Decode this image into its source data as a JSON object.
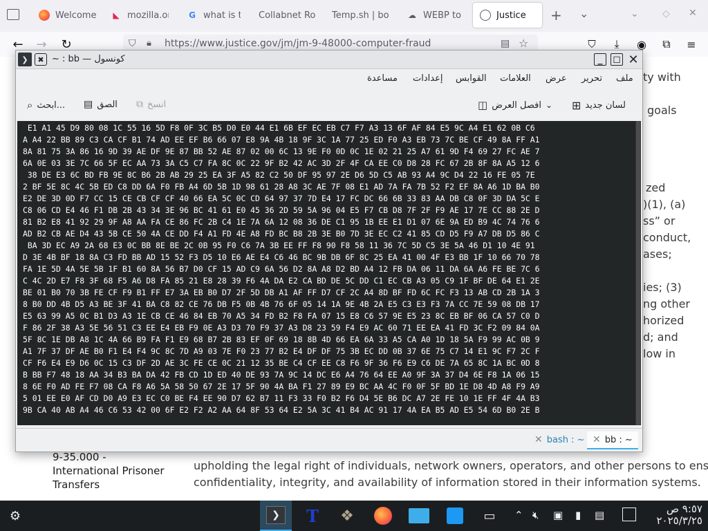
{
  "browser": {
    "tabs": [
      {
        "label": "Welcome",
        "icon": "firefox-icon"
      },
      {
        "label": "mozilla.or",
        "icon": "mozilla-icon"
      },
      {
        "label": "what is th",
        "icon": "google-icon"
      },
      {
        "label": "Collabnet Ro",
        "icon": "page-icon"
      },
      {
        "label": "Temp.sh | bo",
        "icon": "page-icon"
      },
      {
        "label": "WEBP to f",
        "icon": "cloud-icon"
      },
      {
        "label": "Justice",
        "icon": "justice-seal-icon"
      }
    ],
    "url": "https://www.justice.gov/jm/jm-9-48000-computer-fraud"
  },
  "page": {
    "fragments": {
      "ty_with": "ty with",
      "goals": "goals",
      "zed": "zed",
      "one_a": ")(1), (a)",
      "ss_or": "ss” or",
      "conduct": "conduct,",
      "ases": "ases;",
      "ies3": "ies; (3)",
      "ng_other": "ng other",
      "horized": "horized",
      "d_and": "d; and",
      "low_in": "low in"
    },
    "sidebar_link_1": "9-35.000 -",
    "sidebar_link_2": "International Prisoner",
    "sidebar_link_3": "Transfers",
    "para_line_1": "upholding the legal right of individuals, network owners, operators, and other persons to ensure the",
    "para_line_2": "confidentiality, integrity, and availability of information stored in their information systems."
  },
  "konsole": {
    "title": "~ : bb — كونسول",
    "menu": [
      "ملف",
      "تحرير",
      "عرض",
      "العلامات",
      "القوابس",
      "إعدادات",
      "مساعدة"
    ],
    "toolbar": {
      "new_tab": "لسان جديد",
      "split_view": "افصل العرض",
      "copy": "انسخ",
      "paste": "الصق",
      "find": "ابحث..."
    },
    "terminal_lines": [
      " E1 A1 45 D9 80 08 1C 55 16 5D F8 0F 3C B5 D0 E0 44 E1 6B EF EC EB C7 F7 A3 13 6F AF 84 E5 9C A4 E1 62 0B C6",
      "A A4 22 BB 89 C3 CA CF B1 74 AD EE EF B6 66 07 E8 9A 4B 18 9F 3C 1A 77 25 ED F0 A3 EB 73 7C BE CF 49 8A FF A1",
      "8A 81 75 3A 86 16 9D 39 AE DF 9E 87 BB 52 AE 87 02 00 6C 13 9E F0 0D 0C 1E 02 21 25 A7 61 9D F4 69 27 FC AE 7",
      "6A 0E 03 3E 7C 66 5F EC AA 73 3A C5 C7 FA 8C 0C 22 9F B2 42 AC 3D 2F 4F CA EE C0 D8 28 FC 67 2B 8F 8A A5 12 6",
      " 38 DE E3 6C BD FB 9E 8C B6 2B AB 29 25 EA 3F A5 82 C2 50 DF 95 97 2E D6 5D C5 AB 93 A4 9C D4 22 16 FE 05 7E",
      "2 BF 5E 8C 4C 5B ED C8 DD 6A F0 FB A4 6D 5B 1D 98 61 28 A8 3C AE 7F 08 E1 AD 7A FA 7B 52 F2 EF 8A A6 1D BA B0",
      "E2 DE 3D 0D F7 CC 15 CE CB CF CF 40 66 EA 5C 0C CD 64 97 37 7D E4 17 FC DC 66 6B 33 83 AA DB C8 0F 3D DA 5C E",
      "C8 06 CD E4 46 F1 DB 2B 43 34 3E 96 BC 41 61 E0 45 36 2D 59 5A 96 04 E5 F7 CB D8 7F 2F F9 AE 17 7E CC 88 2E D",
      "81 B2 E8 41 92 29 9F A8 AA FA CE 86 FC 2B C4 1E 7A 6A 12 08 36 DE C1 95 1B EE E1 D1 07 6E 9A ED B9 4C 74 76 6",
      "AD B2 CB AE D4 43 5B CE 50 4A CE DD F4 A1 FD 4E A8 FD BC B8 2B 3E B0 7D 3E EC C2 41 85 CD D5 F9 A7 DB D5 86 C",
      " BA 3D EC A9 2A 68 E3 0C BB 8E BE 2C 0B 95 F0 C6 7A 3B EE FF F8 90 F8 58 11 36 7C 5D C5 3E 5A 46 D1 10 4E 91",
      "D 3E 4B BF 18 8A C3 FD BB AD 15 52 F3 D5 10 E6 AE E4 C6 46 BC 9B DB 6F 8C 25 EA 41 00 4F E3 BB 1F 10 66 70 78",
      "FA 1E 5D 4A 5E 5B 1F B1 60 8A 56 B7 D0 CF 15 AD C9 6A 56 D2 8A A8 D2 BD A4 12 FB DA 06 11 DA 6A A6 FE BE 7C 6",
      "C 4C 2D E7 F8 3F 68 F5 A6 D8 FA 85 21 E8 28 39 F6 4A DA E2 CA BD DE 5C DD C1 EC CB A3 05 C9 1F BF DE 64 E1 2E",
      "BE 01 B0 70 3B FE CF F9 B1 FF E7 3A EB B0 D7 2F 5D DB A1 AF FF D7 CF 2C A4 8D BF FD 6C FC F3 13 AB CD 2B 1A 3",
      "8 B0 DD 4B D5 A3 BE 3F 41 BA C8 82 CE 76 DB F5 0B 4B 76 6F 05 14 1A 9E 4B 2A E5 C3 E3 F3 7A CC 7E 59 08 DB 17",
      "E5 63 99 A5 0C B1 D3 A3 1E CB CE 46 84 EB 70 A5 34 FD B2 F8 FA 07 15 E8 C6 57 9E E5 23 8C EB BF 06 CA 57 C0 D",
      "F 86 2F 38 A3 5E 56 51 C3 EE E4 EB F9 0E A3 D3 70 F9 37 A3 D8 23 59 F4 E9 AC 60 71 EE EA 41 FD 3C F2 09 84 0A",
      "5F 8C 1E DB A8 1C 4A 66 B9 FA F1 E9 68 B7 2B 83 EF 0F 69 18 8B 4D 66 EA 6A 33 A5 CA A0 1D 18 5A F9 99 AC 0B 9",
      "A1 7F 37 DF AE B0 F1 E4 F4 9C 8C 7D A9 03 7E F0 23 77 B2 E4 DF DF 75 3B EC DD 0B 37 6E 75 C7 14 E1 9C F7 2C F",
      "CF F6 E4 E9 D6 0C 15 C3 DF 2D AE 3C FE CE 0C 21 12 35 BE C4 CF EE C8 F6 9F 36 F6 E9 C6 DE 7A 65 8C 1A BC 0D 8",
      "B BB F7 48 18 AA 34 B3 BA DA 42 FB CD 1D ED 40 DE 93 7A 9C 14 DC E6 A4 76 64 EE A0 9F 3A 37 D4 6E F8 1A 06 15",
      "8 6E F0 AD FE F7 08 CA F8 A6 5A 58 50 67 2E 17 5F 90 4A BA F1 27 89 E9 BC AA 4C F0 0F 5F BD 1E D8 4D A8 F9 A9",
      "5 01 EE E0 AF CD D0 A9 E3 EC C0 BE F4 EE 90 D7 62 B7 11 F3 33 F0 B2 F6 D4 5E B6 DC A7 2E FE 10 1E FF 4F 4A B3",
      "9B CA 40 AB A4 46 C6 53 42 00 6F E2 F2 A2 AA 64 8F 53 64 E2 5A 3C 41 B4 AC 91 17 4A EA B5 AD E5 54 6D B0 2E B"
    ],
    "tabs": [
      {
        "label": "bash : ~"
      },
      {
        "label": "bb : ~"
      }
    ]
  },
  "taskbar": {
    "time": "٩:٥٧ ص",
    "date": "٢٠٢٥/٣/٢٥"
  },
  "colors": {
    "terminal_bg": "#232627",
    "terminal_fg": "#fcfcfc",
    "accent": "#3daee9",
    "taskbar_bg": "#1b1e20"
  }
}
